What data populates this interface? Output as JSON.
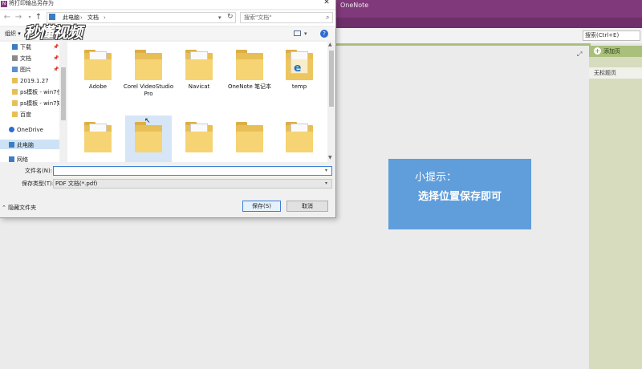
{
  "dialog": {
    "title": "将打印输出另存为",
    "app_icon": "N",
    "close": "✕",
    "breadcrumb": [
      "此电脑",
      "文档"
    ],
    "crumb_sep": "›",
    "search_placeholder": "搜索\"文档\"",
    "organize_label": "组织 ▾",
    "nav_items": [
      {
        "label": "下载",
        "icon": "download-icon",
        "pinned": true
      },
      {
        "label": "文档",
        "icon": "document-icon",
        "pinned": true
      },
      {
        "label": "图片",
        "icon": "picture-icon",
        "pinned": true
      },
      {
        "label": "2019.1.27",
        "icon": "folder-icon",
        "pinned": false
      },
      {
        "label": "ps模板 - win7任",
        "icon": "folder-icon",
        "pinned": false
      },
      {
        "label": "ps模板 - win7知",
        "icon": "folder-icon",
        "pinned": false
      },
      {
        "label": "百度",
        "icon": "folder-icon",
        "pinned": false
      },
      {
        "label": "OneDrive",
        "icon": "cloud-icon",
        "pinned": false
      },
      {
        "label": "此电脑",
        "icon": "computer-icon",
        "pinned": false
      },
      {
        "label": "网络",
        "icon": "network-icon",
        "pinned": false
      }
    ],
    "files_row1": [
      "Adobe",
      "Corel VideoStudio Pro",
      "Navicat",
      "OneNote 笔记本",
      "temp"
    ],
    "files_row2": [
      "",
      "",
      "",
      "",
      ""
    ],
    "filename_label": "文件名(N):",
    "filename_value": "",
    "filetype_label": "保存类型(T):",
    "filetype_value": "PDF 文档(*.pdf)",
    "hide_folders_label": "隐藏文件夹",
    "save_button": "保存(S)",
    "cancel_button": "取消"
  },
  "onenote": {
    "app_title": "OneNote",
    "search_placeholder": "搜索(Ctrl+E)",
    "add_page": "添加页",
    "untitled_page": "无标题页"
  },
  "tip": {
    "title": "小提示：",
    "text": "选择位置保存即可"
  },
  "watermark": "秒懂视频",
  "colors": {
    "onenote_purple": "#80397b",
    "onenote_green": "#a8c07a",
    "tip_blue": "#5f9ddb",
    "folder_yellow": "#f6d474",
    "selection_blue": "#cde2f5"
  }
}
